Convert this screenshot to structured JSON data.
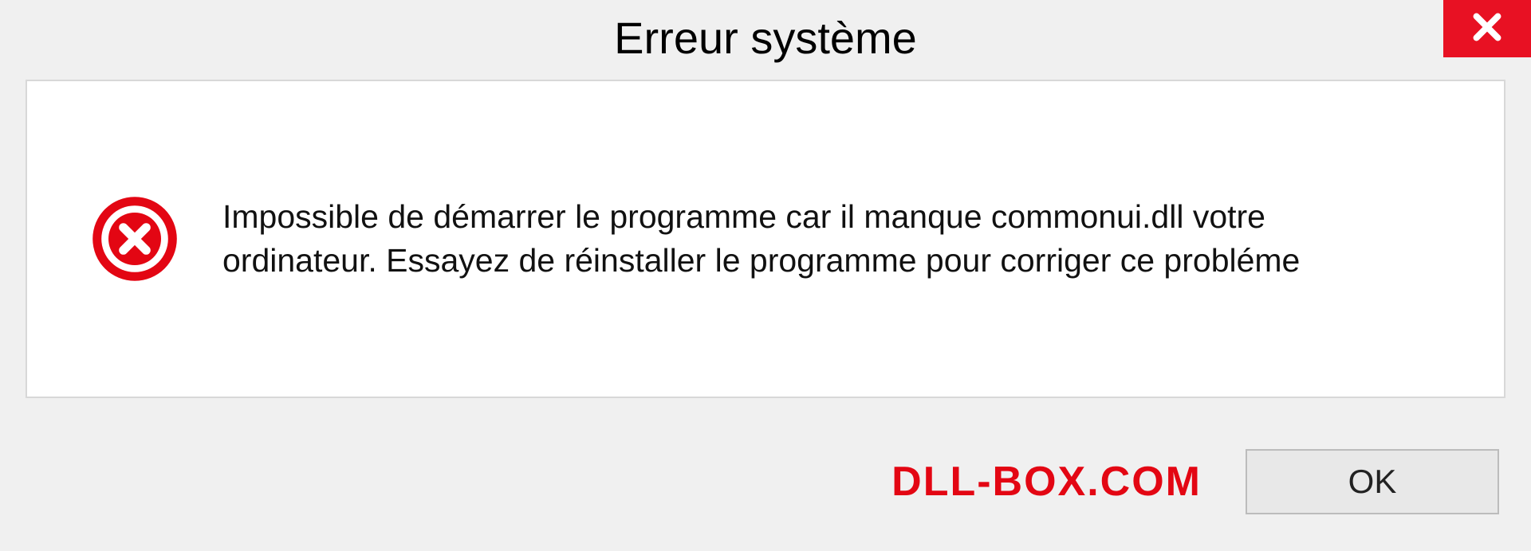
{
  "dialog": {
    "title": "Erreur système",
    "message": "Impossible de démarrer le programme car il manque commonui.dll votre ordinateur. Essayez de réinstaller le programme pour corriger ce probléme",
    "ok_label": "OK"
  },
  "watermark": "DLL-BOX.COM",
  "colors": {
    "close_bg": "#e81123",
    "error_icon": "#e30613",
    "watermark": "#e30613"
  }
}
